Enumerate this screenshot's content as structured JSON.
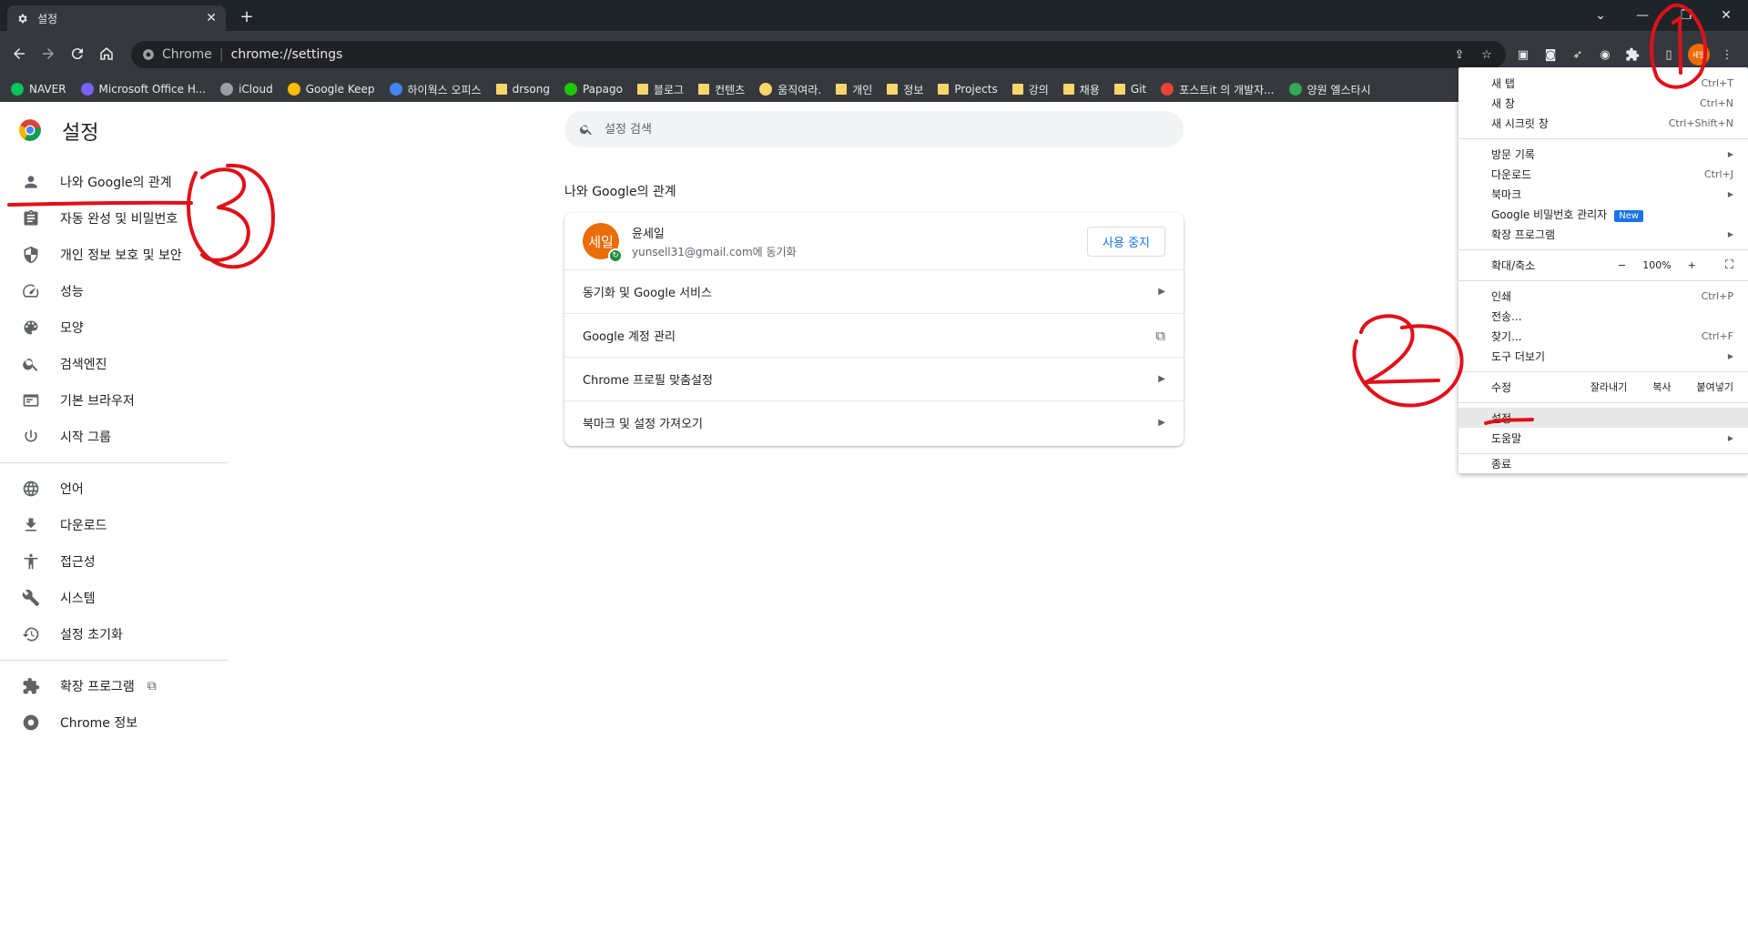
{
  "tab": {
    "title": "설정",
    "close": "✕",
    "new_tab": "+"
  },
  "window": {
    "minimize": "—",
    "restore": "❐",
    "close": "✕",
    "dropdown": "⌄"
  },
  "omnibox": {
    "site": "Chrome",
    "url": "chrome://settings"
  },
  "profile_chip": "세일",
  "bookmarks": [
    {
      "label": "NAVER",
      "color": "#03c75a"
    },
    {
      "label": "Microsoft Office H...",
      "color": "#7b61ff"
    },
    {
      "label": "iCloud",
      "color": "#9aa0a6"
    },
    {
      "label": "Google Keep",
      "color": "#fbbc04"
    },
    {
      "label": "하이웍스 오피스",
      "color": "#4285f4"
    },
    {
      "label": "drsong",
      "color": "folder"
    },
    {
      "label": "Papago",
      "color": "#1ec800"
    },
    {
      "label": "블로그",
      "color": "folder"
    },
    {
      "label": "컨텐츠",
      "color": "folder"
    },
    {
      "label": "움직여라.",
      "color": "#f9d66b"
    },
    {
      "label": "개인",
      "color": "folder"
    },
    {
      "label": "정보",
      "color": "folder"
    },
    {
      "label": "Projects",
      "color": "folder"
    },
    {
      "label": "강의",
      "color": "folder"
    },
    {
      "label": "채용",
      "color": "folder"
    },
    {
      "label": "Git",
      "color": "folder"
    },
    {
      "label": "포스트it 의 개발자...",
      "color": "#ea4335"
    },
    {
      "label": "양원 엘스타시",
      "color": "#34a853"
    }
  ],
  "page": {
    "title": "설정",
    "search_placeholder": "설정 검색"
  },
  "sidebar": {
    "group1": [
      {
        "label": "나와 Google의 관계",
        "icon": "person-icon"
      },
      {
        "label": "자동 완성 및 비밀번호",
        "icon": "clipboard-icon"
      },
      {
        "label": "개인 정보 보호 및 보안",
        "icon": "shield-icon"
      },
      {
        "label": "성능",
        "icon": "speedometer-icon"
      },
      {
        "label": "모양",
        "icon": "palette-icon"
      },
      {
        "label": "검색엔진",
        "icon": "search-icon"
      },
      {
        "label": "기본 브라우저",
        "icon": "browser-icon"
      },
      {
        "label": "시작 그룹",
        "icon": "power-icon"
      }
    ],
    "group2": [
      {
        "label": "언어",
        "icon": "globe-icon"
      },
      {
        "label": "다운로드",
        "icon": "download-icon"
      },
      {
        "label": "접근성",
        "icon": "accessibility-icon"
      },
      {
        "label": "시스템",
        "icon": "wrench-icon"
      },
      {
        "label": "설정 초기화",
        "icon": "history-icon"
      }
    ],
    "group3": [
      {
        "label": "확장 프로그램",
        "icon": "puzzle-icon"
      },
      {
        "label": "Chrome 정보",
        "icon": "chrome-icon"
      }
    ]
  },
  "main": {
    "section_title": "나와 Google의 관계",
    "profile": {
      "avatar_text": "세일",
      "name": "윤세일",
      "email": "yunsell31@gmail.com에 동기화",
      "stop_sync": "사용 중지"
    },
    "rows": [
      {
        "label": "동기화 및 Google 서비스",
        "action": "arrow"
      },
      {
        "label": "Google 계정 관리",
        "action": "external"
      },
      {
        "label": "Chrome 프로필 맞춤설정",
        "action": "arrow"
      },
      {
        "label": "북마크 및 설정 가져오기",
        "action": "arrow"
      }
    ]
  },
  "menu": {
    "new_tab": {
      "label": "새 탭",
      "shortcut": "Ctrl+T"
    },
    "new_window": {
      "label": "새 창",
      "shortcut": "Ctrl+N"
    },
    "new_incognito": {
      "label": "새 시크릿 창",
      "shortcut": "Ctrl+Shift+N"
    },
    "history": {
      "label": "방문 기록"
    },
    "downloads": {
      "label": "다운로드",
      "shortcut": "Ctrl+J"
    },
    "bookmarks": {
      "label": "북마크"
    },
    "password_manager": {
      "label": "Google 비밀번호 관리자",
      "badge": "New"
    },
    "extensions": {
      "label": "확장 프로그램"
    },
    "zoom": {
      "label": "확대/축소",
      "minus": "−",
      "value": "100%",
      "plus": "+"
    },
    "print": {
      "label": "인쇄",
      "shortcut": "Ctrl+P"
    },
    "cast": {
      "label": "전송..."
    },
    "find": {
      "label": "찾기...",
      "shortcut": "Ctrl+F"
    },
    "more_tools": {
      "label": "도구 더보기"
    },
    "edit": {
      "label": "수정",
      "cut": "잘라내기",
      "copy": "복사",
      "paste": "붙여넣기"
    },
    "settings": {
      "label": "설정"
    },
    "help": {
      "label": "도움말"
    },
    "exit": {
      "label": "종료"
    }
  },
  "colors": {
    "accent": "#1a73e8",
    "annotation": "#e0101a",
    "avatar": "#ea6c0b"
  }
}
